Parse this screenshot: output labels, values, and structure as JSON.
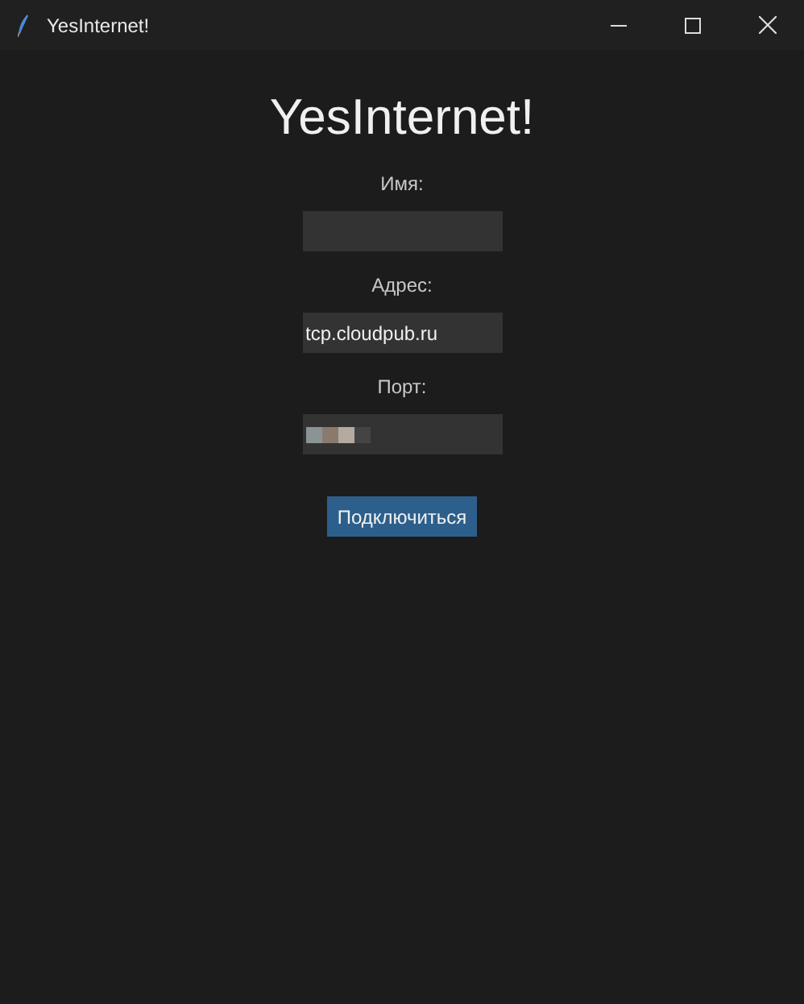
{
  "window": {
    "title": "YesInternet!"
  },
  "heading": "YesInternet!",
  "fields": [
    {
      "label": "Имя:",
      "redacted": false
    },
    {
      "label": "Адрес:",
      "value": "tcp.cloudpub.ru",
      "redacted": false
    },
    {
      "label": "Порт:",
      "redacted": true
    }
  ],
  "connect_button": "Подключиться"
}
